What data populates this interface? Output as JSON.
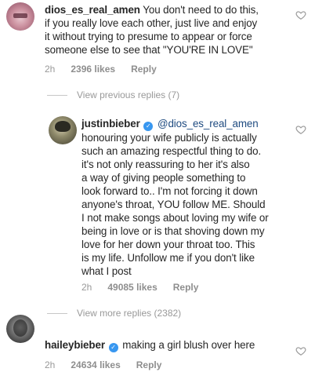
{
  "comments": {
    "top": {
      "username": "dios_es_real_amen",
      "lines": [
        "You don't need to do this,",
        "if you really love each other, just live and enjoy",
        "it without trying to presume to appear or force",
        "someone else to see that \"YOU'RE IN LOVE\""
      ],
      "time": "2h",
      "likes": "2396 likes",
      "reply": "Reply"
    },
    "view_previous": "View previous replies (7)",
    "justin": {
      "username": "justinbieber",
      "mention": "@dios_es_real_amen",
      "lines": [
        "honouring your wife publicly is actually",
        "such an amazing respectful thing to do.",
        "it's not only reassuring to her it's also",
        "a way of giving people something to",
        "look forward to.. I'm not forcing it down",
        "anyone's throat, YOU follow ME. Should",
        "I not make songs about loving my wife or",
        "being in love or is that shoving down my",
        "love for her down your throat too. This",
        "is my life. Unfollow me if you don't like",
        "what I post"
      ],
      "time": "2h",
      "likes": "49085 likes",
      "reply": "Reply"
    },
    "view_more": "View more replies (2382)",
    "hailey": {
      "username": "haileybieber",
      "text": "making a girl blush over here",
      "time": "2h",
      "likes": "24634 likes",
      "reply": "Reply"
    }
  },
  "icons": {
    "like": "heart-outline-icon",
    "verified": "verified-badge-icon"
  },
  "colors": {
    "text": "#262626",
    "meta": "#999999",
    "mention": "#1f4b80",
    "verified": "#3897f0"
  }
}
